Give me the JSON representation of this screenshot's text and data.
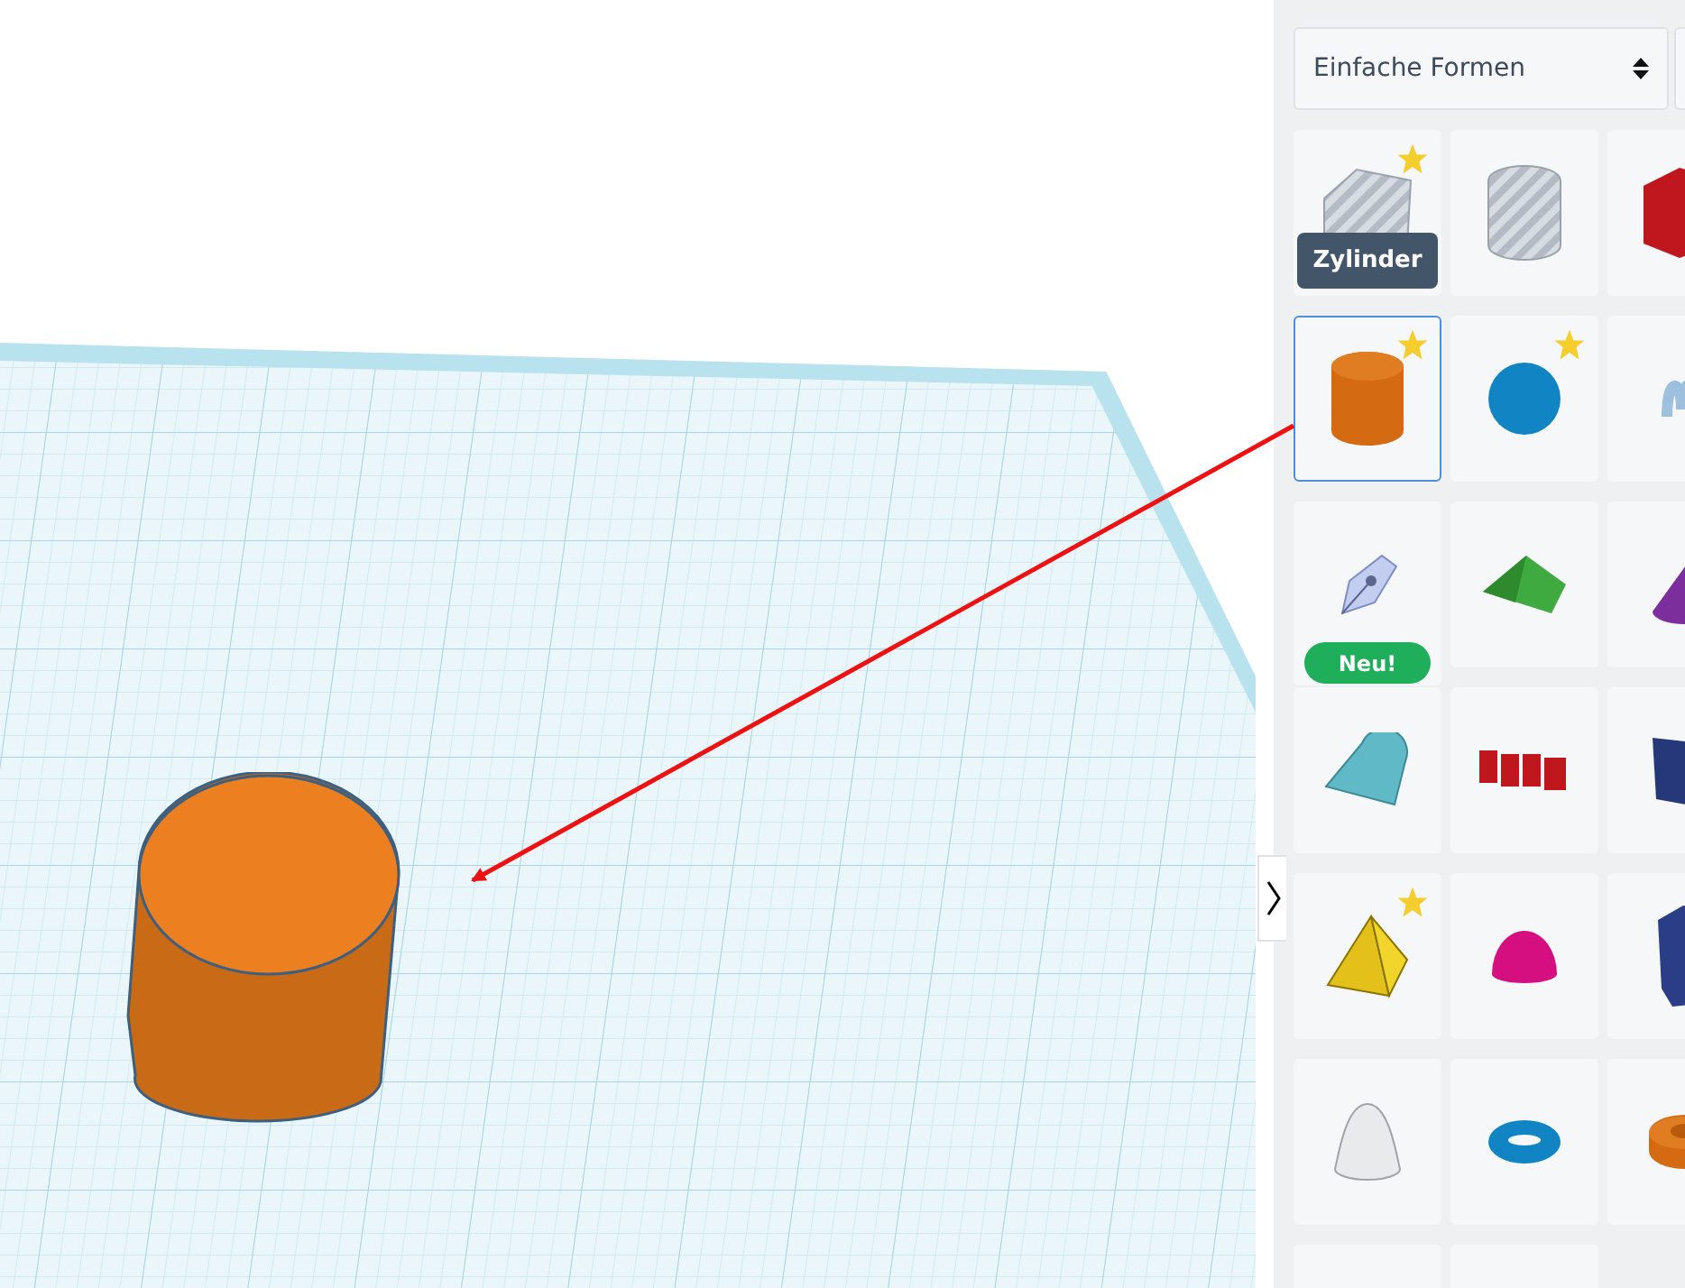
{
  "panel": {
    "category": "Einfache Formen",
    "tooltip": "Zylinder",
    "shapes": [
      {
        "kind": "box-striped",
        "starred": true,
        "selected": false
      },
      {
        "kind": "cylinder-striped",
        "starred": false,
        "selected": false
      },
      {
        "kind": "box-red",
        "starred": false,
        "selected": false
      },
      {
        "kind": "cylinder",
        "starred": true,
        "selected": true
      },
      {
        "kind": "sphere",
        "starred": true,
        "selected": false
      },
      {
        "kind": "scribble",
        "starred": false,
        "selected": false
      },
      {
        "kind": "pen",
        "starred": false,
        "selected": false,
        "badge": "Neu!"
      },
      {
        "kind": "roof",
        "starred": false,
        "selected": false
      },
      {
        "kind": "cone",
        "starred": false,
        "selected": false
      },
      {
        "kind": "round-roof",
        "starred": false,
        "selected": false
      },
      {
        "kind": "text",
        "starred": false,
        "selected": false
      },
      {
        "kind": "wedge",
        "starred": false,
        "selected": false
      },
      {
        "kind": "pyramid",
        "starred": true,
        "selected": false
      },
      {
        "kind": "half-sphere",
        "starred": false,
        "selected": false
      },
      {
        "kind": "polygon",
        "starred": false,
        "selected": false
      },
      {
        "kind": "paraboloid",
        "starred": false,
        "selected": false
      },
      {
        "kind": "torus",
        "starred": false,
        "selected": false
      },
      {
        "kind": "tube",
        "starred": false,
        "selected": false
      },
      {
        "kind": "blank",
        "starred": false,
        "selected": false
      },
      {
        "kind": "blank",
        "starred": false,
        "selected": false
      }
    ]
  }
}
